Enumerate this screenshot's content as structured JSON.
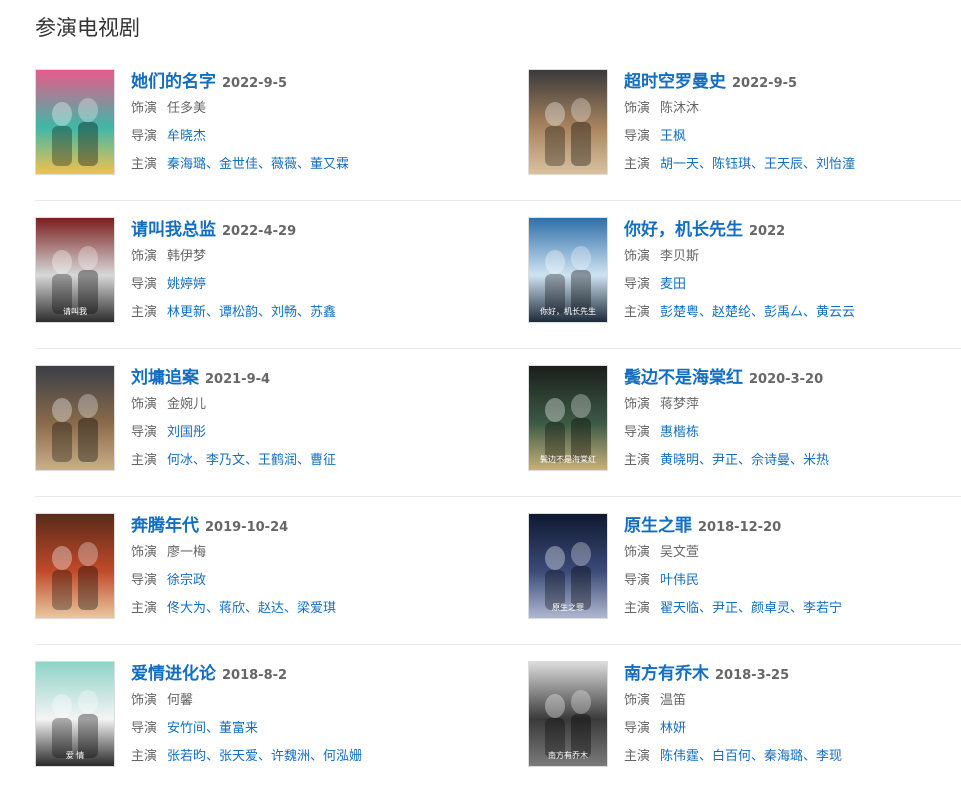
{
  "section_title": "参演电视剧",
  "labels": {
    "role": "饰演",
    "director": "导演",
    "cast": "主演"
  },
  "dramas": [
    {
      "title": "她们的名字",
      "date": "2022-9-5",
      "role": "任多美",
      "director": "牟晓杰",
      "cast": "秦海璐、金世佳、薇薇、董又霖"
    },
    {
      "title": "超时空罗曼史",
      "date": "2022-9-5",
      "role": "陈沐沐",
      "director": "王枫",
      "cast": "胡一天、陈钰琪、王天辰、刘怡潼"
    },
    {
      "title": "请叫我总监",
      "date": "2022-4-29",
      "role": "韩伊梦",
      "director": "姚婷婷",
      "cast": "林更新、谭松韵、刘畅、苏鑫"
    },
    {
      "title": "你好，机长先生",
      "date": "2022",
      "role": "李贝斯",
      "director": "麦田",
      "cast": "彭楚粤、赵楚纶、彭禹厶、黄云云"
    },
    {
      "title": "刘墉追案",
      "date": "2021-9-4",
      "role": "金婉儿",
      "director": "刘国彤",
      "cast": "何冰、李乃文、王鹤润、曹征"
    },
    {
      "title": "鬓边不是海棠红",
      "date": "2020-3-20",
      "role": "蒋梦萍",
      "director": "惠楷栋",
      "cast": "黄晓明、尹正、佘诗曼、米热"
    },
    {
      "title": "奔腾年代",
      "date": "2019-10-24",
      "role": "廖一梅",
      "director": "徐宗政",
      "cast": "佟大为、蒋欣、赵达、梁爱琪"
    },
    {
      "title": "原生之罪",
      "date": "2018-12-20",
      "role": "吴文萱",
      "director": "叶伟民",
      "cast": "翟天临、尹正、颜卓灵、李若宁"
    },
    {
      "title": "爱情进化论",
      "date": "2018-8-2",
      "role": "何馨",
      "director": "安竹间、董富来",
      "cast": "张若昀、张天爱、许魏洲、何泓姗"
    },
    {
      "title": "南方有乔木",
      "date": "2018-3-25",
      "role": "温笛",
      "director": "林妍",
      "cast": "陈伟霆、白百何、秦海璐、李现"
    }
  ],
  "poster_colors": [
    [
      "#e85a8a",
      "#3fb7a8",
      "#f2c14e"
    ],
    [
      "#3a3a3a",
      "#a8845e",
      "#d9c2a0"
    ],
    [
      "#7a1f1f",
      "#d8d8d8",
      "#2d2d2d"
    ],
    [
      "#2f6fa8",
      "#cfe3f2",
      "#1d2a3a"
    ],
    [
      "#3b3f48",
      "#8a6a4a",
      "#c9b08a"
    ],
    [
      "#1a1f1c",
      "#3c5a44",
      "#c8b07a"
    ],
    [
      "#5a2a1a",
      "#c04a2a",
      "#e8c8a0"
    ],
    [
      "#0f1830",
      "#3a4b78",
      "#b0b8d0"
    ],
    [
      "#8fd3c8",
      "#f4f4f4",
      "#2a2a2a"
    ],
    [
      "#dcdcdc",
      "#3a3a3a",
      "#7a7a7a"
    ]
  ],
  "poster_texts": [
    "",
    "",
    "请叫我",
    "你好，机长先生",
    "",
    "鬓边不是海棠红",
    "",
    "原生之罪",
    "爱 情",
    "南方有乔木"
  ]
}
